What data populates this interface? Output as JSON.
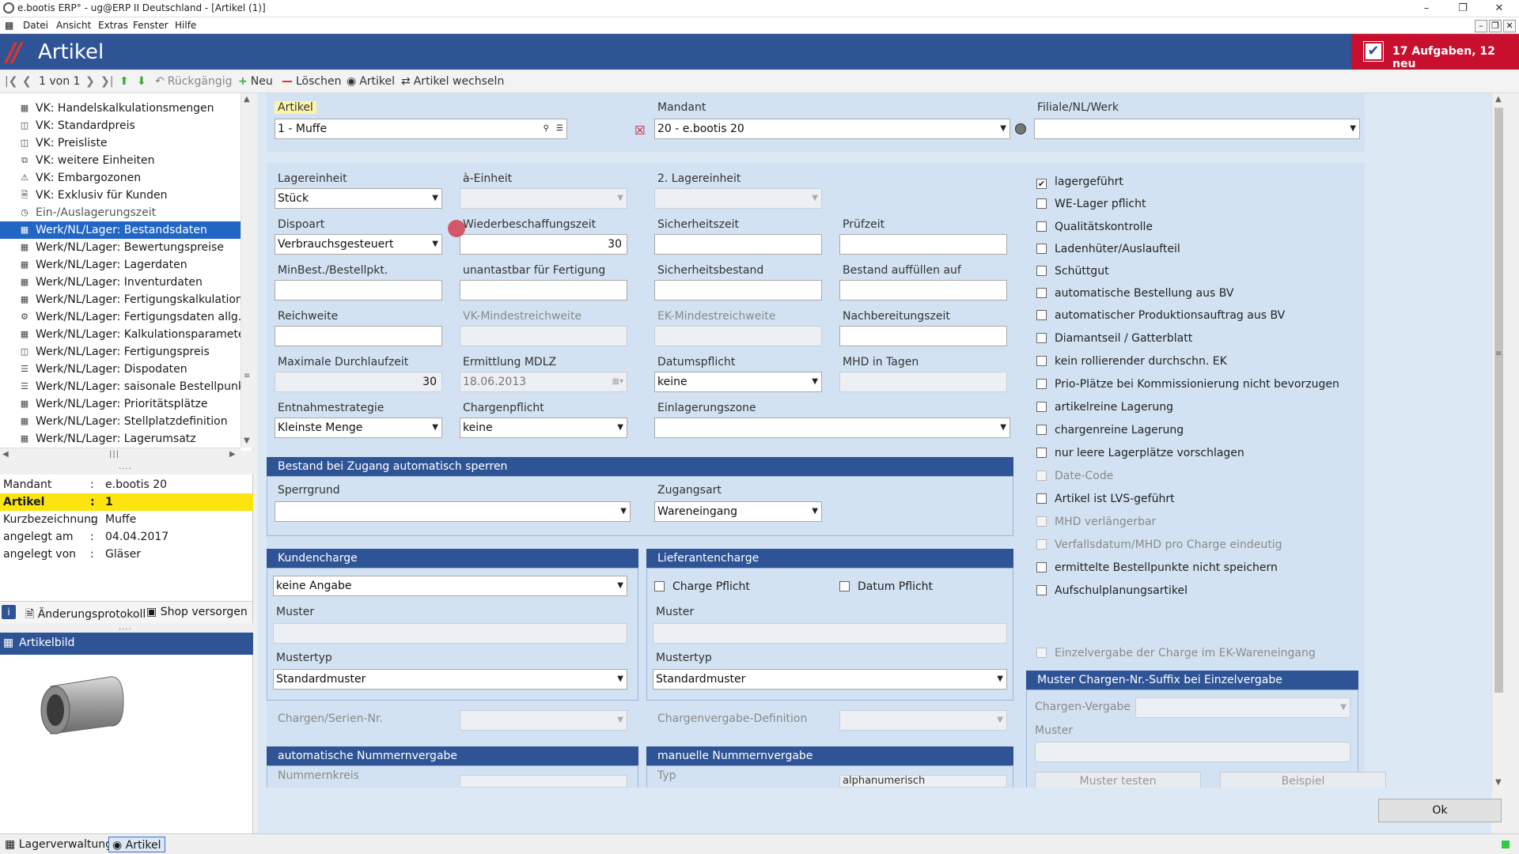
{
  "window": {
    "title": "e.bootis ERP° - ug@ERP II Deutschland - [Artikel (1)]",
    "minimize": "–",
    "maximize": "❐",
    "close": "✕",
    "mdi_min": "–",
    "mdi_restore": "❐",
    "mdi_close": "✕"
  },
  "menu": {
    "items": [
      "Datei",
      "Ansicht",
      "Extras",
      "Fenster",
      "Hilfe"
    ]
  },
  "header": {
    "title": "Artikel",
    "slashes": "//",
    "tasks": "17 Aufgaben, 12 neu",
    "task_icon": "✔"
  },
  "toolbar": {
    "pager": "1 von 1",
    "undo": "Rückgängig",
    "new": "Neu",
    "delete": "Löschen",
    "article": "Artikel",
    "switch_article": "Artikel wechseln"
  },
  "tree": {
    "items": [
      "VK: Handelskalkulationsmengen",
      "VK: Standardpreis",
      "VK: Preisliste",
      "VK: weitere Einheiten",
      "VK: Embargozonen",
      "VK: Exklusiv für Kunden",
      "Ein-/Auslagerungszeit",
      "Werk/NL/Lager: Bestandsdaten",
      "Werk/NL/Lager: Bewertungspreise",
      "Werk/NL/Lager: Lagerdaten",
      "Werk/NL/Lager: Inventurdaten",
      "Werk/NL/Lager: Fertigungskalkulation",
      "Werk/NL/Lager: Fertigungsdaten allg.",
      "Werk/NL/Lager: Kalkulationsparameter",
      "Werk/NL/Lager: Fertigungspreis",
      "Werk/NL/Lager: Dispodaten",
      "Werk/NL/Lager: saisonale Bestellpunkte",
      "Werk/NL/Lager: Prioritätsplätze",
      "Werk/NL/Lager: Stellplatzdefinition",
      "Werk/NL/Lager: Lagerumsatz"
    ]
  },
  "info": {
    "rows": [
      {
        "k": "Mandant",
        "v": "e.bootis 20"
      },
      {
        "k": "Artikel",
        "v": "1"
      },
      {
        "k": "Kurzbezeichnung",
        "v": "Muffe"
      },
      {
        "k": "angelegt am",
        "v": "04.04.2017"
      },
      {
        "k": "angelegt von",
        "v": "Gläser"
      }
    ],
    "sep": ":",
    "tab_changelog": "Änderungsprotokoll",
    "tab_shop": "Shop versorgen",
    "image_header": "Artikelbild"
  },
  "form": {
    "artikel_label": "Artikel",
    "artikel_value": "1 - Muffe",
    "mandant_label": "Mandant",
    "mandant_value": "20 - e.bootis 20",
    "filiale_label": "Filiale/NL/Werk",
    "filiale_value": "",
    "lagereinheit_label": "Lagereinheit",
    "lagereinheit_value": "Stück",
    "a_einheit_label": "à-Einheit",
    "lagereinheit2_label": "2. Lagereinheit",
    "dispoart_label": "Dispoart",
    "dispoart_value": "Verbrauchsgesteuert",
    "wbz_label": "Wiederbeschaffungszeit",
    "wbz_value": "30",
    "sicherheitszeit_label": "Sicherheitszeit",
    "pruefzeit_label": "Prüfzeit",
    "minbest_label": "MinBest./Bestellpkt.",
    "unantastbar_label": "unantastbar für Fertigung",
    "sicherheitsbestand_label": "Sicherheitsbestand",
    "bestand_auffuellen_label": "Bestand auffüllen auf",
    "reichweite_label": "Reichweite",
    "vk_mindest_label": "VK-Mindestreichweite",
    "ek_mindest_label": "EK-Mindestreichweite",
    "nachbereitung_label": "Nachbereitungszeit",
    "max_dlz_label": "Maximale Durchlaufzeit",
    "max_dlz_value": "30",
    "mdlz_label": "Ermittlung MDLZ",
    "mdlz_value": "18.06.2013",
    "datumspflicht_label": "Datumspflicht",
    "datumspflicht_value": "keine",
    "mhd_label": "MHD in Tagen",
    "entnahme_label": "Entnahmestrategie",
    "entnahme_value": "Kleinste Menge",
    "chargenpflicht_label": "Chargenpflicht",
    "chargenpflicht_value": "keine",
    "einlagerungszone_label": "Einlagerungszone",
    "sperr_section": "Bestand bei Zugang automatisch sperren",
    "sperrgrund_label": "Sperrgrund",
    "zugangsart_label": "Zugangsart",
    "zugangsart_value": "Wareneingang",
    "kundencharge_section": "Kundencharge",
    "kunden_value": "keine Angabe",
    "kunden_muster_label": "Muster",
    "kunden_mustertyp_label": "Mustertyp",
    "kunden_mustertyp_value": "Standardmuster",
    "lieferantencharge_section": "Lieferantencharge",
    "charge_pflicht": "Charge Pflicht",
    "datum_pflicht": "Datum Pflicht",
    "lief_muster_label": "Muster",
    "lief_mustertyp_label": "Mustertyp",
    "lief_mustertyp_value": "Standardmuster",
    "chargen_serien_label": "Chargen/Serien-Nr.",
    "chargenvergabe_def_label": "Chargenvergabe-Definition",
    "auto_nr_section": "automatische Nummernvergabe",
    "nummernkreis_label": "Nummernkreis",
    "manuell_nr_section": "manuelle Nummernvergabe",
    "typ_label": "Typ",
    "typ_value": "alphanumerisch"
  },
  "checkboxes": [
    {
      "label": "lagergeführt",
      "checked": true,
      "enabled": true
    },
    {
      "label": "WE-Lager pflicht",
      "checked": false,
      "enabled": true
    },
    {
      "label": "Qualitätskontrolle",
      "checked": false,
      "enabled": true
    },
    {
      "label": "Ladenhüter/Auslaufteil",
      "checked": false,
      "enabled": true
    },
    {
      "label": "Schüttgut",
      "checked": false,
      "enabled": true
    },
    {
      "label": "automatische Bestellung aus BV",
      "checked": false,
      "enabled": true
    },
    {
      "label": "automatischer Produktionsauftrag aus BV",
      "checked": false,
      "enabled": true
    },
    {
      "label": "Diamantseil / Gatterblatt",
      "checked": false,
      "enabled": true
    },
    {
      "label": "kein rollierender durchschn. EK",
      "checked": false,
      "enabled": true
    },
    {
      "label": "Prio-Plätze bei Kommissionierung nicht bevorzugen",
      "checked": false,
      "enabled": true
    },
    {
      "label": "artikelreine Lagerung",
      "checked": false,
      "enabled": true
    },
    {
      "label": "chargenreine Lagerung",
      "checked": false,
      "enabled": true
    },
    {
      "label": "nur leere Lagerplätze vorschlagen",
      "checked": false,
      "enabled": true
    },
    {
      "label": "Date-Code",
      "checked": false,
      "enabled": false
    },
    {
      "label": "Artikel ist LVS-geführt",
      "checked": false,
      "enabled": true
    },
    {
      "label": "MHD verlängerbar",
      "checked": false,
      "enabled": false
    },
    {
      "label": "Verfallsdatum/MHD pro Charge eindeutig",
      "checked": false,
      "enabled": false
    },
    {
      "label": "ermittelte Bestellpunkte nicht speichern",
      "checked": false,
      "enabled": true
    },
    {
      "label": "Aufschulplanungsartikel",
      "checked": false,
      "enabled": true
    }
  ],
  "einzelvergabe": "Einzelvergabe der Charge im EK-Wareneingang",
  "suffix_section": "Muster Chargen-Nr.-Suffix bei Einzelvergabe",
  "chargen_vergabe_label": "Chargen-Vergabe",
  "suffix_muster_label": "Muster",
  "muster_testen": "Muster testen",
  "beispiel": "Beispiel",
  "ok": "Ok",
  "status_tabs": [
    "Lagerverwaltung",
    "Artikel"
  ],
  "colors": {
    "header_blue": "#2f5496",
    "task_red": "#c8102e",
    "selection_blue": "#2166c4",
    "highlight_yellow": "#fde40e"
  }
}
